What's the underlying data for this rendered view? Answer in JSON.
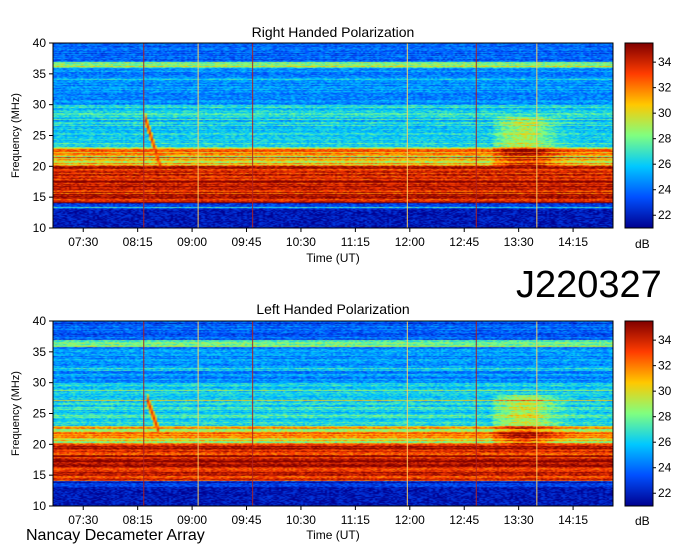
{
  "station_id": "J220327",
  "observatory": "Nancay Decameter Array",
  "chart_data": [
    {
      "type": "heatmap",
      "title": "Right Handed Polarization",
      "xlabel": "Time (UT)",
      "ylabel": "Frequency (MHz)",
      "colorbar_label": "dB",
      "x_ticks": [
        "07:30",
        "08:15",
        "09:00",
        "09:45",
        "10:30",
        "11:15",
        "12:00",
        "12:45",
        "13:30",
        "14:15"
      ],
      "x_tick_minutes": [
        450,
        495,
        540,
        585,
        630,
        675,
        720,
        765,
        810,
        855
      ],
      "xlim_minutes": [
        425,
        888
      ],
      "y_ticks": [
        10,
        15,
        20,
        25,
        30,
        35,
        40
      ],
      "ylim": [
        10,
        40
      ],
      "clim": [
        21,
        35.5
      ],
      "colorbar_ticks": [
        22,
        24,
        26,
        28,
        30,
        32,
        34
      ],
      "colormap": [
        "#00008f",
        "#0050ff",
        "#00c8ff",
        "#80ff80",
        "#ffc800",
        "#ff3c00",
        "#800000"
      ],
      "bursts": [
        {
          "start_minutes": 502,
          "end_minutes": 518,
          "freq_high": 27,
          "freq_low": 17
        }
      ]
    },
    {
      "type": "heatmap",
      "title": "Left Handed Polarization",
      "xlabel": "Time (UT)",
      "ylabel": "Frequency (MHz)",
      "colorbar_label": "dB",
      "x_ticks": [
        "07:30",
        "08:15",
        "09:00",
        "09:45",
        "10:30",
        "11:15",
        "12:00",
        "12:45",
        "13:30",
        "14:15"
      ],
      "x_tick_minutes": [
        450,
        495,
        540,
        585,
        630,
        675,
        720,
        765,
        810,
        855
      ],
      "xlim_minutes": [
        425,
        888
      ],
      "y_ticks": [
        10,
        15,
        20,
        25,
        30,
        35,
        40
      ],
      "ylim": [
        10,
        40
      ],
      "clim": [
        21,
        35.5
      ],
      "colorbar_ticks": [
        22,
        24,
        26,
        28,
        30,
        32,
        34
      ],
      "colormap": [
        "#00008f",
        "#0050ff",
        "#00c8ff",
        "#80ff80",
        "#ffc800",
        "#ff3c00",
        "#800000"
      ],
      "bursts": [
        {
          "start_minutes": 503,
          "end_minutes": 512,
          "freq_high": 27,
          "freq_low": 22
        }
      ]
    }
  ]
}
